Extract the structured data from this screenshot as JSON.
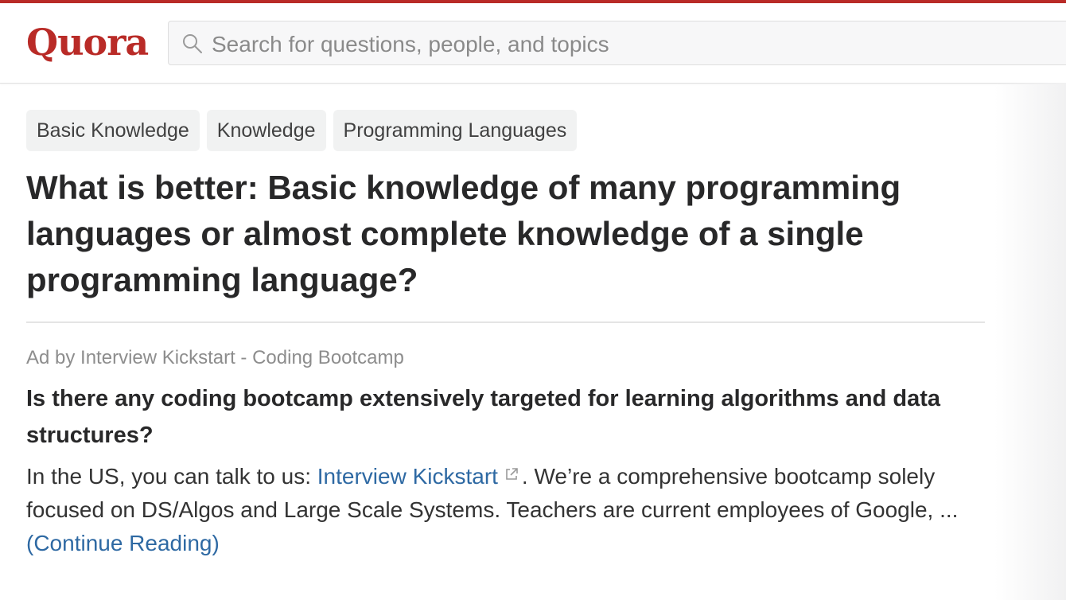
{
  "header": {
    "logo_text": "Quora",
    "search": {
      "placeholder": "Search for questions, people, and topics",
      "value": "",
      "icon": "search-icon"
    }
  },
  "colors": {
    "brand": "#b92b27",
    "link": "#2e69a3",
    "chip_bg": "#f1f2f2"
  },
  "topics": [
    {
      "label": "Basic Knowledge"
    },
    {
      "label": "Knowledge"
    },
    {
      "label": "Programming Languages"
    }
  ],
  "question": {
    "title": "What is better: Basic knowledge of many programming languages or almost complete knowledge of a single programming language?"
  },
  "ad": {
    "label": "Ad by Interview Kickstart - Coding Bootcamp",
    "title": "Is there any coding bootcamp extensively targeted for learning algorithms and data structures?",
    "body_prefix": "In the US, you can talk to us: ",
    "link_text": "Interview Kickstart",
    "link_icon": "external-link-icon",
    "body_suffix": ". We’re a comprehensive bootcamp solely focused on DS/Algos and Large Scale Systems. Teachers are current employees of Google, ... ",
    "continue_text": "(Continue Reading)"
  }
}
